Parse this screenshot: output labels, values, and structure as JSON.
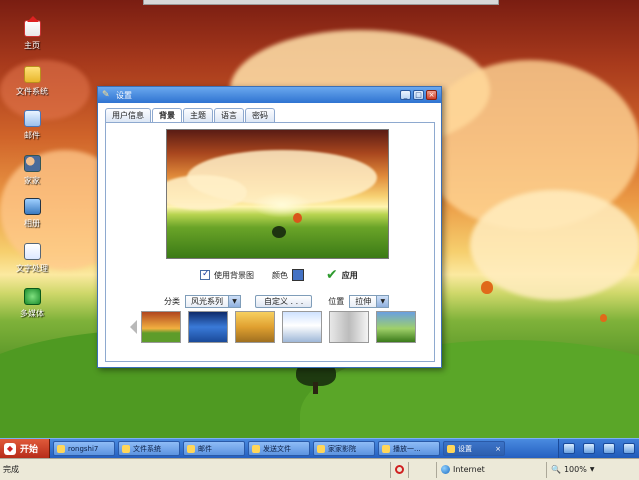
{
  "desktop": {
    "icons": [
      {
        "label": "主页",
        "icon": "home-icon"
      },
      {
        "label": "文件系统",
        "icon": "folder-icon"
      },
      {
        "label": "邮件",
        "icon": "mail-icon"
      },
      {
        "label": "家家",
        "icon": "people-icon"
      },
      {
        "label": "相册",
        "icon": "photo-icon"
      },
      {
        "label": "文字处理",
        "icon": "document-icon"
      },
      {
        "label": "多媒体",
        "icon": "media-player-icon"
      }
    ]
  },
  "window": {
    "title": "设置",
    "controls": {
      "minimize": "_",
      "maximize": "□",
      "close": "×"
    },
    "tabs": [
      {
        "label": "用户信息",
        "active": false
      },
      {
        "label": "背景",
        "active": true
      },
      {
        "label": "主题",
        "active": false
      },
      {
        "label": "语言",
        "active": false
      },
      {
        "label": "密码",
        "active": false
      }
    ],
    "use_background_label": "使用背景图",
    "use_background_checked": true,
    "color_label": "颜色",
    "color_value": "#4472c4",
    "apply_label": "应用",
    "category_label": "分类",
    "category_value": "风光系列",
    "custom_button": "自定义 . . .",
    "position_label": "位置",
    "position_value": "拉伸"
  },
  "taskbar": {
    "start_label": "开始",
    "tasks": [
      {
        "label": "rongshi7",
        "active": false
      },
      {
        "label": "文件系统",
        "active": false
      },
      {
        "label": "邮件",
        "active": false
      },
      {
        "label": "发送文件",
        "active": false
      },
      {
        "label": "家家影院",
        "active": false
      },
      {
        "label": "播放一...",
        "active": false
      },
      {
        "label": "设置",
        "active": true,
        "close": "×"
      }
    ]
  },
  "statusbar": {
    "left": "完成",
    "zone": "Internet",
    "zoom": "100%"
  }
}
